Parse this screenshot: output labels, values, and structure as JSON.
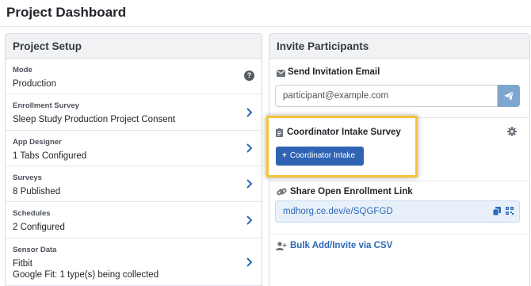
{
  "page": {
    "title": "Project Dashboard"
  },
  "setup": {
    "header": "Project Setup",
    "rows": [
      {
        "label": "Mode",
        "value": "Production",
        "icon": "help-icon"
      },
      {
        "label": "Enrollment Survey",
        "value": "Sleep Study Production Project Consent",
        "icon": "chevron-right-icon"
      },
      {
        "label": "App Designer",
        "value": "1 Tabs Configured",
        "icon": "chevron-right-icon"
      },
      {
        "label": "Surveys",
        "value": "8 Published",
        "icon": "chevron-right-icon"
      },
      {
        "label": "Schedules",
        "value": "2 Configured",
        "icon": "chevron-right-icon"
      },
      {
        "label": "Sensor Data",
        "value": "Fitbit",
        "value2": "Google Fit: 1 type(s) being collected",
        "icon": "chevron-right-icon"
      }
    ],
    "help_glyph": "?"
  },
  "invite": {
    "header": "Invite Participants",
    "email_section": "Send Invitation Email",
    "email_placeholder": "participant@example.com",
    "intake_section": "Coordinator Intake Survey",
    "intake_button": "Coordinator Intake",
    "intake_button_glyph": "+",
    "link_section": "Share Open Enrollment Link",
    "link_value": "mdhorg.ce.dev/e/SQGFGD",
    "bulk_label": "Bulk Add/Invite via CSV"
  },
  "colors": {
    "accent": "#2f64b4",
    "link": "#2c67b7",
    "highlight": "#f5c33b",
    "send_button": "#7fa6cf"
  }
}
